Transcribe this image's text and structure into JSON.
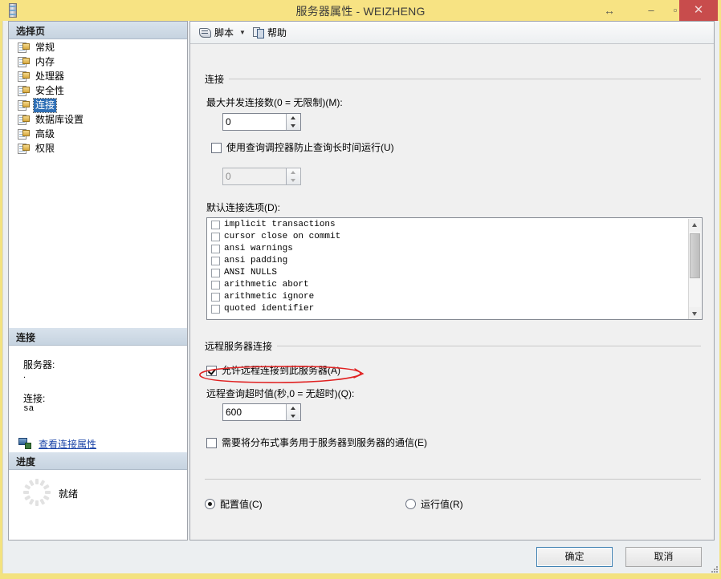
{
  "window": {
    "title": "服务器属性 - WEIZHENG",
    "app_icon": "server-icon",
    "controls": {
      "resize": "↔",
      "minimize": "–",
      "maximize": "▫",
      "close": "✕"
    },
    "titlebar_color": "#f7e383",
    "close_color": "#c84c4c"
  },
  "toolbar": {
    "script_label": "脚本",
    "script_icon": "script-icon",
    "dropdown_arrow": "▼",
    "help_label": "帮助",
    "help_icon": "help-icon"
  },
  "sidebar": {
    "select_page": {
      "header": "选择页",
      "items": [
        {
          "label": "常规",
          "selected": false
        },
        {
          "label": "内存",
          "selected": false
        },
        {
          "label": "处理器",
          "selected": false
        },
        {
          "label": "安全性",
          "selected": false
        },
        {
          "label": "连接",
          "selected": true
        },
        {
          "label": "数据库设置",
          "selected": false
        },
        {
          "label": "高级",
          "selected": false
        },
        {
          "label": "权限",
          "selected": false
        }
      ]
    },
    "connection": {
      "header": "连接",
      "server_label": "服务器:",
      "server_value": ".",
      "conn_label": "连接:",
      "conn_value": "sa",
      "link_text": "查看连接属性",
      "link_icon": "connection-properties-icon",
      "link_color": "#1b44a8"
    },
    "progress": {
      "header": "进度",
      "status": "就绪",
      "spinner_icon": "loading-spinner-icon"
    }
  },
  "main": {
    "group_connections": "连接",
    "max_conn_label": "最大并发连接数(0 = 无限制)(M):",
    "max_conn_value": "0",
    "query_governor_label": "使用查询调控器防止查询长时间运行(U)",
    "query_governor_checked": false,
    "query_governor_value": "0",
    "default_options_label": "默认连接选项(D):",
    "default_options": [
      {
        "label": "implicit transactions",
        "checked": false
      },
      {
        "label": "cursor close on commit",
        "checked": false
      },
      {
        "label": "ansi warnings",
        "checked": false
      },
      {
        "label": "ansi padding",
        "checked": false
      },
      {
        "label": "ANSI NULLS",
        "checked": false
      },
      {
        "label": "arithmetic abort",
        "checked": false
      },
      {
        "label": "arithmetic ignore",
        "checked": false
      },
      {
        "label": "quoted identifier",
        "checked": false
      }
    ],
    "group_remote": "远程服务器连接",
    "allow_remote_label": "允许远程连接到此服务器(A)",
    "allow_remote_checked": true,
    "remote_timeout_label": "远程查询超时值(秒,0 = 无超时)(Q):",
    "remote_timeout_value": "600",
    "dtc_label": "需要将分布式事务用于服务器到服务器的通信(E)",
    "dtc_checked": false,
    "radio_configured": "配置值(C)",
    "radio_running": "运行值(R)",
    "radio_selected": "configured"
  },
  "footer": {
    "ok_label": "确定",
    "cancel_label": "取消"
  },
  "annotation": {
    "type": "hand-drawn-ellipse",
    "color": "#e02020",
    "targets": "allow-remote-connections-checkbox"
  }
}
